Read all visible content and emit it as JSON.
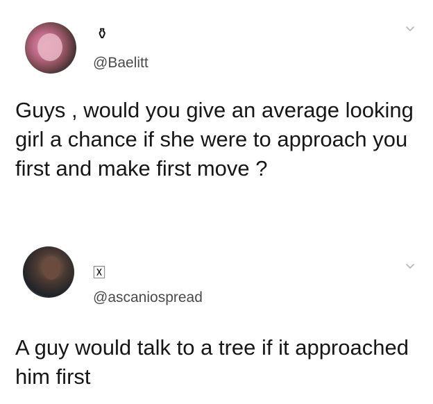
{
  "tweets": [
    {
      "display_name_glyph": "⚱",
      "handle": "@Baelitt",
      "text": "Guys , would you give an average looking girl a chance if she were to approach you first and make first move ?",
      "avatar_icon": "profile-photo",
      "menu_icon": "chevron-down-icon"
    },
    {
      "display_name_glyph": "🅇",
      "handle": "@ascaniospread",
      "text": "A guy would talk to a tree if it approached him first",
      "avatar_icon": "profile-photo",
      "menu_icon": "chevron-down-icon"
    }
  ],
  "colors": {
    "background": "#ffffff",
    "text": "#161616",
    "handle": "#4a4a4a",
    "chevron": "#b8b8b8"
  }
}
